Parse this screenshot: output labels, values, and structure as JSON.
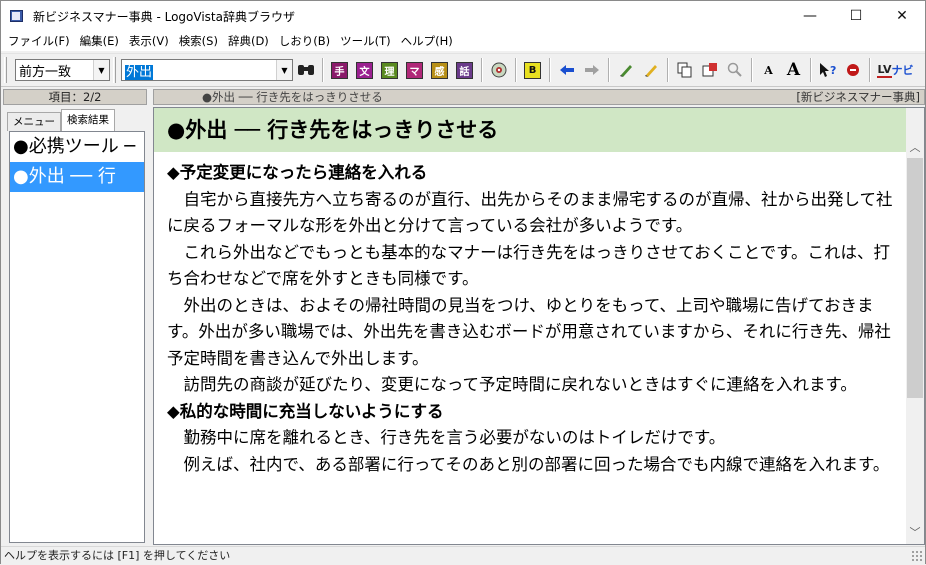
{
  "window": {
    "title": "新ビジネスマナー事典 - LogoVista辞典ブラウザ",
    "controls": {
      "minimize": "—",
      "maximize": "☐",
      "close": "✕"
    }
  },
  "menu": [
    "ファイル(F)",
    "編集(E)",
    "表示(V)",
    "検索(S)",
    "辞典(D)",
    "しおり(B)",
    "ツール(T)",
    "ヘルプ(H)"
  ],
  "toolbar": {
    "search_mode": "前方一致",
    "search_text": "外出",
    "dict_buttons": [
      {
        "label": "手",
        "color": "#8a1a6a"
      },
      {
        "label": "文",
        "color": "#9a2090"
      },
      {
        "label": "理",
        "color": "#5a8a20"
      },
      {
        "label": "マ",
        "color": "#b02878"
      },
      {
        "label": "感",
        "color": "#b89018"
      },
      {
        "label": "話",
        "color": "#6a3a8a"
      }
    ],
    "b_label": "B",
    "font_small": "A",
    "font_large": "A",
    "lv_label": "LV",
    "navi_label": "ナビ"
  },
  "left": {
    "header": "項目：2/2",
    "tabs": [
      "メニュー",
      "検索結果"
    ],
    "items": [
      "●必携ツール ─",
      "●外出 ── 行"
    ]
  },
  "right": {
    "crumb": "●外出 ── 行き先をはっきりさせる",
    "dict_name": "[新ビジネスマナー事典]",
    "entry_title": "●外出 ── 行き先をはっきりさせる",
    "sections": [
      {
        "title": "◆予定変更になったら連絡を入れる",
        "paragraphs": [
          "自宅から直接先方へ立ち寄るのが直行、出先からそのまま帰宅するのが直帰、社から出発して社に戻るフォーマルな形を外出と分けて言っている会社が多いようです。",
          "これら外出などでもっとも基本的なマナーは行き先をはっきりさせておくことです。これは、打ち合わせなどで席を外すときも同様です。",
          "外出のときは、およその帰社時間の見当をつけ、ゆとりをもって、上司や職場に告げておきます。外出が多い職場では、外出先を書き込むボードが用意されていますから、それに行き先、帰社予定時間を書き込んで外出します。",
          "訪問先の商談が延びたり、変更になって予定時間に戻れないときはすぐに連絡を入れます。"
        ]
      },
      {
        "title": "◆私的な時間に充当しないようにする",
        "paragraphs": [
          "勤務中に席を離れるとき、行き先を言う必要がないのはトイレだけです。",
          "例えば、社内で、ある部署に行ってそのあと別の部署に回った場合でも内線で連絡を入れます。"
        ]
      }
    ]
  },
  "status": "ヘルプを表示するには [F1] を押してください"
}
